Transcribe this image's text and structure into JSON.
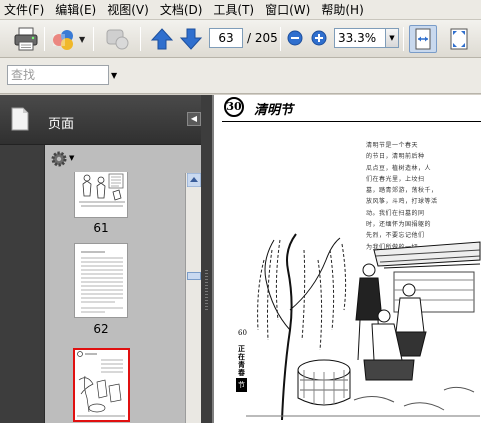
{
  "menu": {
    "items": [
      "文件(F)",
      "编辑(E)",
      "视图(V)",
      "文档(D)",
      "工具(T)",
      "窗口(W)",
      "帮助(H)"
    ]
  },
  "toolbar": {
    "current_page": "63",
    "page_total": "/ 205",
    "zoom": "33.3%"
  },
  "find": {
    "placeholder": "查找"
  },
  "nav_panel": {
    "title": "页面",
    "thumbnails": [
      {
        "label": "61"
      },
      {
        "label": "62"
      },
      {
        "label": ""
      }
    ]
  },
  "document": {
    "chapter_number": "30",
    "chapter_title": "清明节",
    "body_lines": [
      "清明节是一个春天",
      "的节日，清明前后种",
      "瓜点豆，植树造林，人",
      "们在春光里，上坟扫",
      "墓，踏青郊游，荡秋千，",
      "放风筝，斗鸡，打球等活",
      "动。我们在扫墓的同",
      "时，还缅怀为国捐躯的",
      "先烈，不要忘记他们",
      "为我们所做的一切……"
    ],
    "side_page_number": "60",
    "side_caption": "正在青春",
    "side_tab": "节"
  },
  "colors": {
    "menubar_bg": "#eceae4",
    "nav_bg": "#3d3d3d",
    "thumb_bg": "#bdbdbd",
    "selected_border": "#e01010",
    "button_blue": "#2f6fce"
  }
}
